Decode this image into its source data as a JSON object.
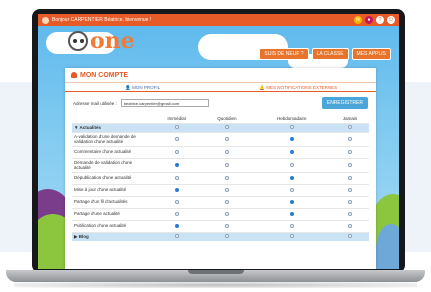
{
  "topbar": {
    "greeting": "Bonjour CARPENTIER Béatrice, bienvenue !",
    "icons": [
      "mail-icon",
      "user-icon",
      "help-icon",
      "power-icon"
    ],
    "color": "#e65b27"
  },
  "logo": {
    "text": "one"
  },
  "nav": {
    "buttons": [
      "SUIS DE NEUF ?",
      "LA CLASSE",
      "MES APPLIS"
    ]
  },
  "account": {
    "title": "MON COMPTE",
    "tabs": [
      "MON PROFIL",
      "MES NOTIFICATIONS EXTERNES"
    ],
    "active_tab": 1,
    "email_label": "Adresse mail utilisée :",
    "email_value": "beatrice.carpentier@gmail.com",
    "save_label": "ENREGISTRER"
  },
  "table": {
    "columns": [
      "",
      "Immédiat",
      "Quotidien",
      "Hebdomadaire",
      "Jamais"
    ],
    "groups": [
      {
        "label": "Actualités",
        "expanded": true,
        "rows": [
          {
            "label": "A-validation d'une demande de validation d'une actualité",
            "selected": 2
          },
          {
            "label": "Commentaire d'une actualité",
            "selected": 2
          },
          {
            "label": "Demande de validation d'une actualité",
            "selected": 0
          },
          {
            "label": "Dépublication d'une actualité",
            "selected": 2
          },
          {
            "label": "Mise à jour d'une actualité",
            "selected": 0
          },
          {
            "label": "Partage d'un fil d'actualités",
            "selected": 2
          },
          {
            "label": "Partage d'une actualité",
            "selected": 2
          },
          {
            "label": "Publication d'une actualité",
            "selected": 0
          }
        ]
      },
      {
        "label": "Blog",
        "expanded": false,
        "rows": []
      }
    ]
  },
  "colors": {
    "accent": "#e65b27",
    "sky": "#7cc8f0",
    "group_row": "#c9e3f5",
    "radio_on": "#2a7bd8"
  }
}
